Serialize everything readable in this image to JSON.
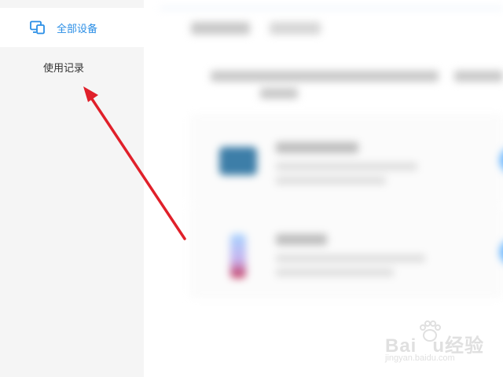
{
  "sidebar": {
    "items": [
      {
        "label": "全部设备",
        "icon": "devices-icon",
        "active": true
      },
      {
        "label": "使用记录",
        "active": false
      }
    ]
  },
  "colors": {
    "sidebar_bg": "#f5f5f5",
    "active_text": "#2a8ee6",
    "arrow": "#e0202a",
    "button_blue": "#64b4ff"
  },
  "watermark": {
    "brand_prefix": "Bai",
    "brand_suffix": "u",
    "brand_cn": "经验",
    "url": "jingyan.baidu.com"
  }
}
